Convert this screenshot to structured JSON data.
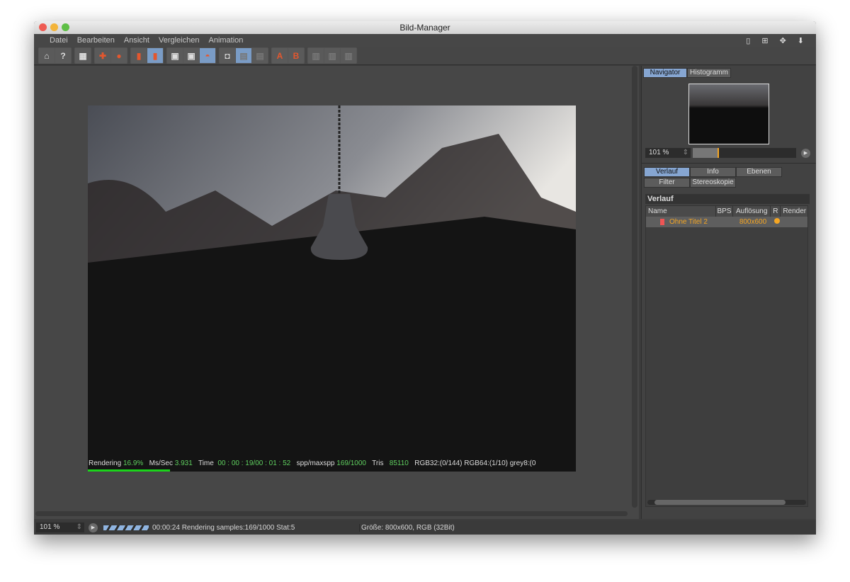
{
  "window": {
    "title": "Bild-Manager"
  },
  "menu": [
    "Datei",
    "Bearbeiten",
    "Ansicht",
    "Vergleichen",
    "Animation"
  ],
  "hud": {
    "rendering_label": "Rendering",
    "rendering_value": "16.9%",
    "ms_label": "Ms/Sec",
    "ms_value": "3.931",
    "time_label": "Time",
    "time_value": "00 : 00 : 19/00 : 01 : 52",
    "spp_label": "spp/maxspp",
    "spp_value": "169/1000",
    "tris_label": "Tris",
    "tris_value": "85110",
    "rgb32": "RGB32:(0/144)",
    "rgb64": "RGB64:(1/10)",
    "grey8": "grey8:(0",
    "progress": 0.169
  },
  "navigator": {
    "tabs": [
      "Navigator",
      "Histogramm"
    ],
    "zoom": "101 %"
  },
  "panel": {
    "tabs_row1": [
      "Verlauf",
      "Info",
      "Ebenen"
    ],
    "tabs_row2": [
      "Filter",
      "Stereoskopie"
    ],
    "section_title": "Verlauf",
    "columns": [
      "Name",
      "BPS",
      "Auflösung",
      "R",
      "Render"
    ],
    "rows": [
      {
        "name": "Ohne Titel 2",
        "bps": "",
        "resolution": "800x600",
        "status_color": "#f5a623"
      }
    ]
  },
  "status": {
    "zoom": "101 %",
    "message": "00:00:24 Rendering samples:169/1000 Stat:5",
    "size": "Größe: 800x600, RGB (32Bit)"
  },
  "colors": {
    "accent": "#86a6d2",
    "orange": "#f5a623",
    "hud_green": "#5fcf5f"
  }
}
